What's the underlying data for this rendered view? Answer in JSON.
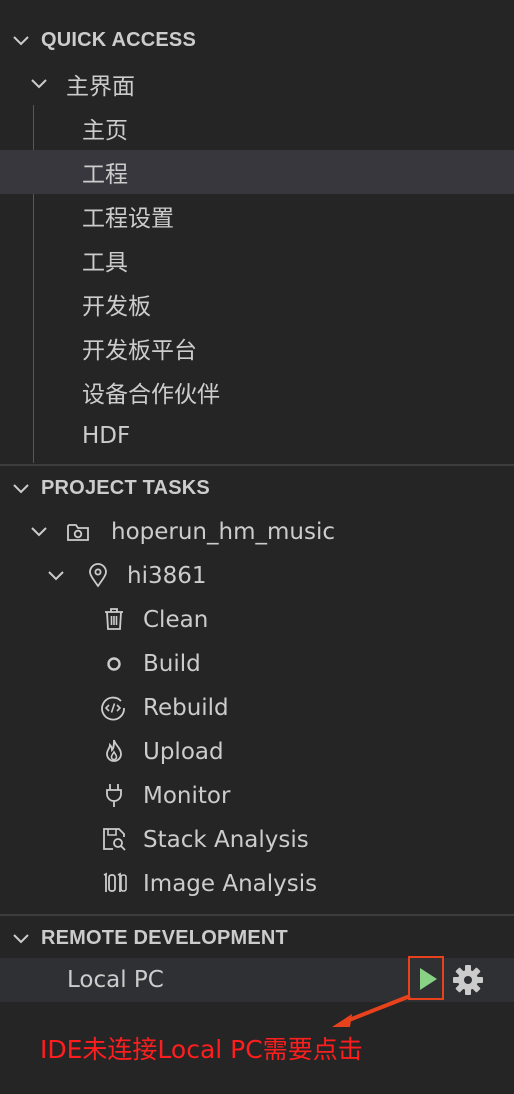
{
  "quick_access": {
    "header": "QUICK ACCESS",
    "group_label": "主界面",
    "items": [
      "主页",
      "工程",
      "工程设置",
      "工具",
      "开发板",
      "开发板平台",
      "设备合作伙伴",
      "HDF"
    ],
    "selected_item": "工程"
  },
  "project_tasks": {
    "header": "PROJECT TASKS",
    "project": {
      "label": "hoperun_hm_music",
      "icon": "project-folder-icon"
    },
    "target": {
      "label": "hi3861",
      "icon": "location-pin-icon"
    },
    "tasks": [
      {
        "label": "Clean",
        "icon": "trash-icon"
      },
      {
        "label": "Build",
        "icon": "circle-icon"
      },
      {
        "label": "Rebuild",
        "icon": "code-circle-icon"
      },
      {
        "label": "Upload",
        "icon": "flame-icon"
      },
      {
        "label": "Monitor",
        "icon": "plug-icon"
      },
      {
        "label": "Stack Analysis",
        "icon": "save-search-icon"
      },
      {
        "label": "Image Analysis",
        "icon": "binary-icon"
      }
    ]
  },
  "remote_development": {
    "header": "REMOTE DEVELOPMENT",
    "item_label": "Local PC",
    "actions": {
      "connect": "play-icon",
      "settings": "gear-icon"
    }
  },
  "annotation": {
    "text": "IDE未连接Local PC需要点击"
  },
  "colors": {
    "background": "#252526",
    "selection": "#37373d",
    "text": "#cccccc",
    "play_green": "#89d185",
    "highlight_red": "#e8421c",
    "annotation_red": "#ff1e1e"
  }
}
